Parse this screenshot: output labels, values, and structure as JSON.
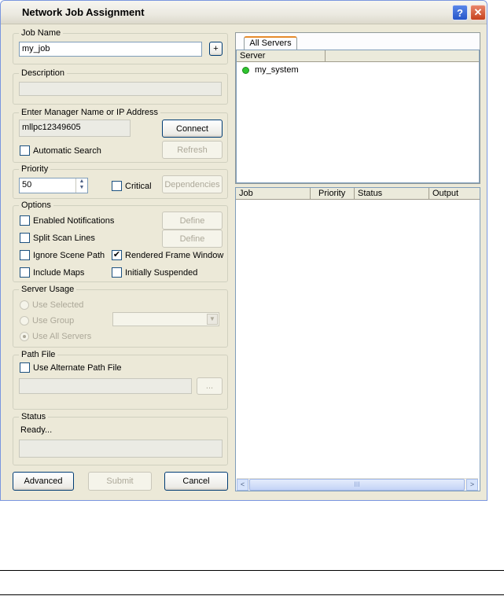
{
  "window": {
    "title": "Network Job Assignment",
    "help_label": "?",
    "close_label": "✕"
  },
  "job_name": {
    "label": "Job Name",
    "value": "my_job",
    "plus_label": "+"
  },
  "description": {
    "label": "Description",
    "value": ""
  },
  "manager": {
    "label": "Enter Manager Name or IP Address",
    "value": "mllpc12349605",
    "connect_label": "Connect",
    "refresh_label": "Refresh",
    "auto_search_label": "Automatic Search"
  },
  "priority": {
    "label": "Priority",
    "value": "50",
    "critical_label": "Critical",
    "dependencies_label": "Dependencies"
  },
  "options": {
    "label": "Options",
    "enabled_notifications": "Enabled Notifications",
    "split_scan_lines": "Split Scan Lines",
    "ignore_scene_path": "Ignore Scene Path",
    "rendered_frame_window": "Rendered Frame Window",
    "include_maps": "Include Maps",
    "initially_suspended": "Initially Suspended",
    "define1": "Define",
    "define2": "Define",
    "check_mark": "✔"
  },
  "server_usage": {
    "label": "Server Usage",
    "use_selected": "Use Selected",
    "use_group": "Use Group",
    "use_all": "Use All Servers"
  },
  "path_file": {
    "label": "Path File",
    "use_alternate": "Use Alternate Path File",
    "browse_label": "..."
  },
  "status": {
    "label": "Status",
    "text": "Ready..."
  },
  "buttons": {
    "advanced": "Advanced",
    "submit": "Submit",
    "cancel": "Cancel"
  },
  "servers": {
    "tab": "All Servers",
    "column": "Server",
    "items": [
      {
        "name": "my_system",
        "status_color": "#2fc42f"
      }
    ]
  },
  "jobs": {
    "columns": [
      "Job",
      "Priority",
      "Status",
      "Output"
    ],
    "scroll_left": "<",
    "scroll_right": ">",
    "thumb_grip": "III"
  }
}
